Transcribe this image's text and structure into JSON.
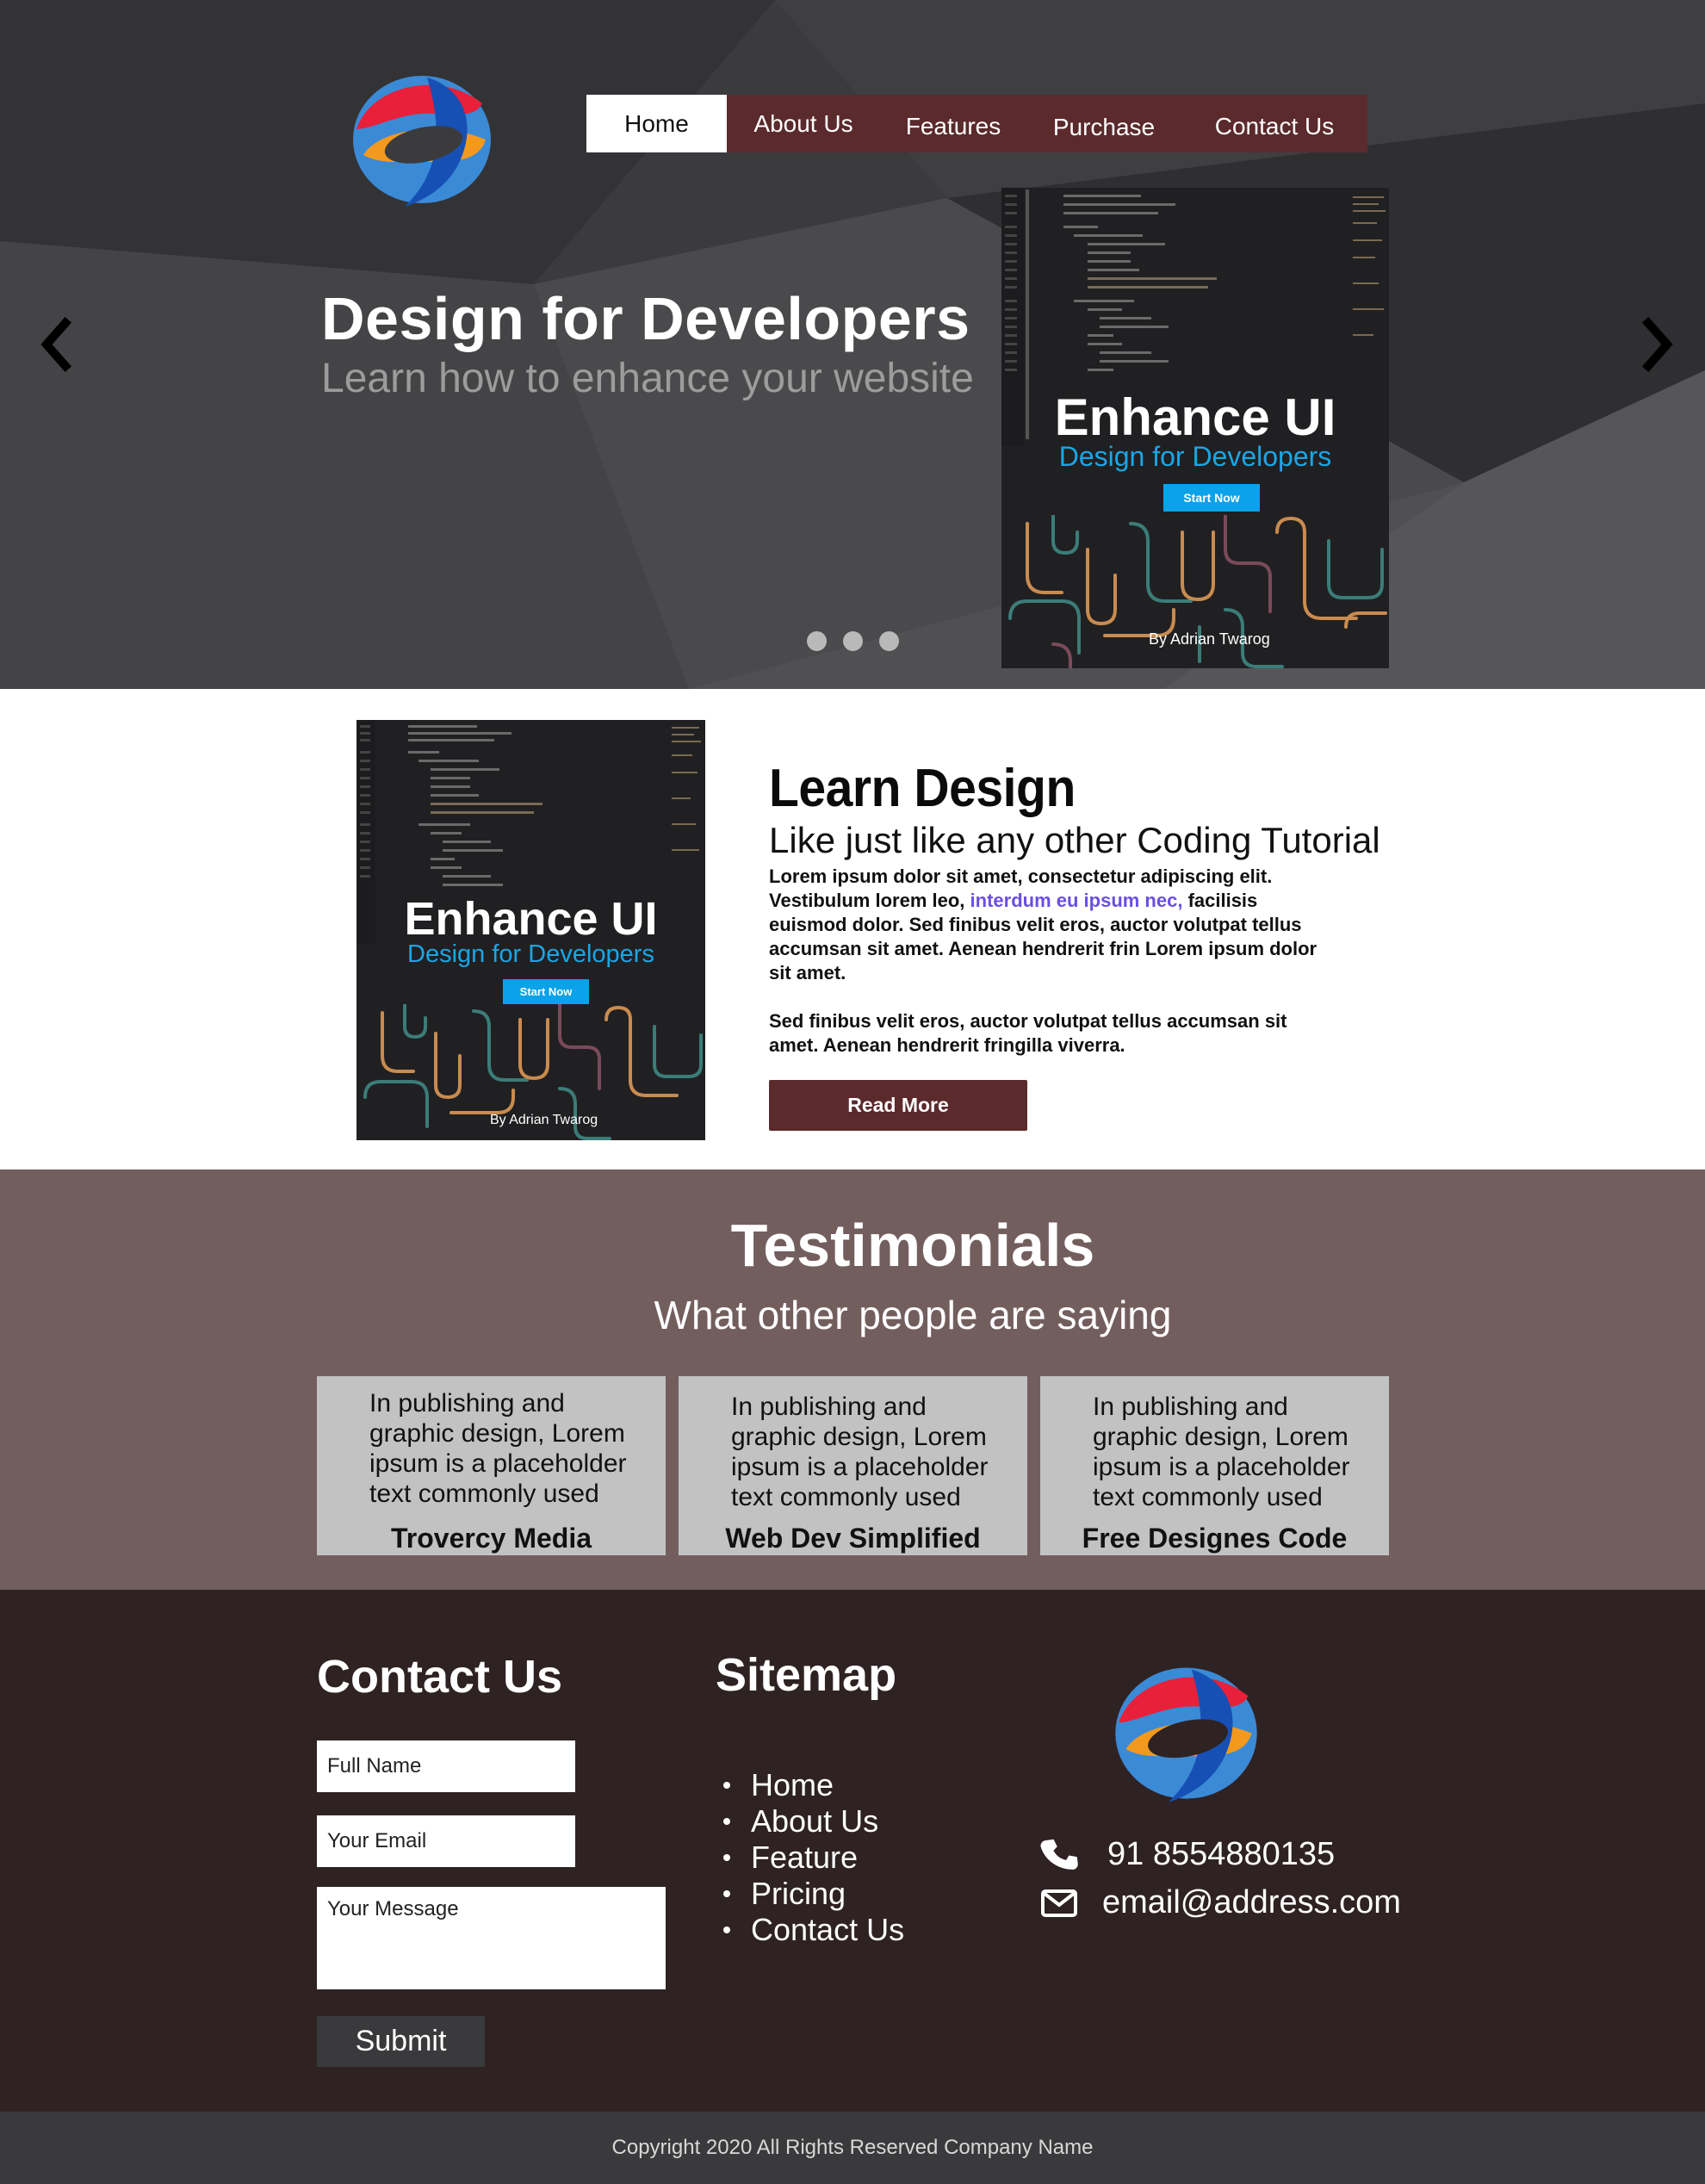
{
  "nav": {
    "items": [
      {
        "label": "Home",
        "active": true
      },
      {
        "label": "About Us"
      },
      {
        "label": "Features"
      },
      {
        "label": "Purchase"
      },
      {
        "label": "Contact Us"
      }
    ]
  },
  "hero": {
    "title": "Design for Developers",
    "subtitle": "Learn how to enhance your website",
    "prev_icon": "chevron-left-icon",
    "next_icon": "chevron-right-icon",
    "slide_count": 3
  },
  "book": {
    "title": "Enhance UI",
    "subtitle": "Design for Developers",
    "button": "Start Now",
    "author": "By Adrian Twarog"
  },
  "learn": {
    "title": "Learn Design",
    "subtitle": "Like just like any other Coding Tutorial",
    "p1_a": "Lorem ipsum dolor sit amet, consectetur adipiscing elit. Vestibulum lorem leo, ",
    "p1_link": "interdum eu ipsum nec,",
    "p1_b": " facilisis euismod dolor. Sed finibus velit eros, auctor volutpat tellus accumsan sit amet. Aenean hendrerit frin Lorem ipsum dolor sit amet.",
    "p2": "Sed finibus velit eros, auctor volutpat tellus accumsan sit amet. Aenean hendrerit fringilla viverra.",
    "button": "Read More"
  },
  "testimonials": {
    "title": "Testimonials",
    "subtitle": "What other people are saying",
    "cards": [
      {
        "quote": "In publishing and graphic design, Lorem ipsum is a placeholder text commonly used",
        "author": "Trovercy Media"
      },
      {
        "quote": "In publishing and graphic design, Lorem ipsum is a placeholder text commonly used",
        "author": "Web Dev Simplified"
      },
      {
        "quote": "In publishing and graphic design, Lorem ipsum is a placeholder text commonly used",
        "author": "Free Designes Code"
      }
    ]
  },
  "footer": {
    "contact_title": "Contact Us",
    "name_placeholder": "Full Name",
    "email_placeholder": "Your Email",
    "message_placeholder": "Your Message",
    "submit": "Submit",
    "sitemap_title": "Sitemap",
    "sitemap": [
      "Home",
      "About Us",
      "Feature",
      "Pricing",
      "Contact Us"
    ],
    "phone": "91 8554880135",
    "email": "email@address.com",
    "phone_icon": "phone-icon",
    "email_icon": "envelope-icon"
  },
  "copyright": "Copyright 2020 All Rights Reserved Company Name",
  "colors": {
    "hero_bg": "#3d3d3f",
    "nav_bg": "#5b2a2c",
    "testimonials_bg": "#735e5e",
    "card_bg": "#c2c2c2",
    "footer_bg": "#2f2223",
    "copyright_bg": "#3a3a3c",
    "accent_blue": "#0aa2e9",
    "link_purple": "#6a4fe0"
  }
}
